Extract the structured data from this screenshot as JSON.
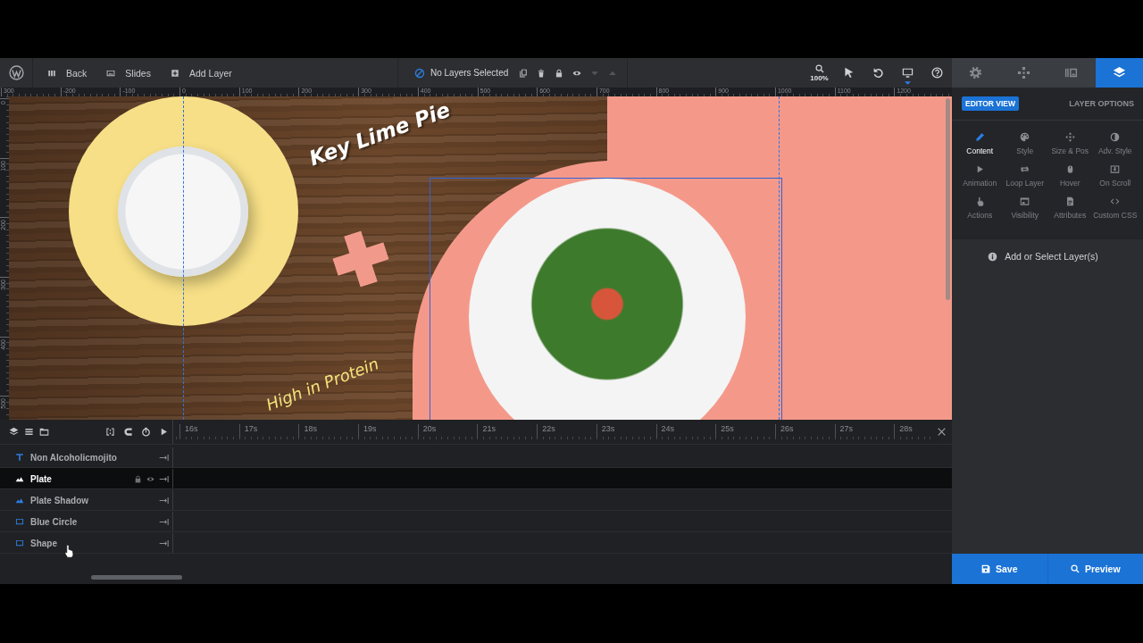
{
  "toolbar": {
    "nav": [
      {
        "kind": "back",
        "label": "Back"
      },
      {
        "kind": "slides",
        "label": "Slides"
      },
      {
        "kind": "add",
        "label": "Add Layer"
      }
    ],
    "selection": "No Layers Selected",
    "layer_actions": [
      {
        "kind": "copy",
        "disabled": false
      },
      {
        "kind": "delete",
        "disabled": false
      },
      {
        "kind": "lock",
        "disabled": false
      },
      {
        "kind": "visibility",
        "disabled": false
      },
      {
        "kind": "move-down",
        "disabled": true
      },
      {
        "kind": "move-up",
        "disabled": true
      }
    ],
    "tools": [
      {
        "kind": "zoom",
        "label": "100%"
      },
      {
        "kind": "pointer"
      },
      {
        "kind": "undo"
      },
      {
        "kind": "device"
      },
      {
        "kind": "help"
      }
    ]
  },
  "panel_tabs": [
    {
      "kind": "settings",
      "selected": false
    },
    {
      "kind": "navigation",
      "selected": false
    },
    {
      "kind": "slides",
      "selected": false
    },
    {
      "kind": "layers",
      "selected": true
    }
  ],
  "ruler": {
    "x_labels": [
      "300",
      "-200",
      "-100",
      "0",
      "100",
      "200",
      "300",
      "400",
      "500",
      "600",
      "700",
      "800",
      "900",
      "1000",
      "1100",
      "1200"
    ],
    "y_labels": [
      "0",
      "100",
      "200",
      "300",
      "400",
      "500"
    ]
  },
  "canvas": {
    "title": "Key Lime Pie",
    "tagline": "High in Protein"
  },
  "timeline": {
    "view_tools": [
      {
        "kind": "layers"
      },
      {
        "kind": "list"
      },
      {
        "kind": "folder"
      }
    ],
    "playback_tools": [
      {
        "kind": "snap"
      },
      {
        "kind": "magnet"
      },
      {
        "kind": "timer"
      },
      {
        "kind": "play"
      }
    ],
    "time_labels": [
      "16s",
      "17s",
      "18s",
      "19s",
      "20s",
      "21s",
      "22s",
      "23s",
      "24s",
      "25s",
      "26s",
      "27s",
      "28s"
    ],
    "layers": [
      {
        "kind": "text",
        "name": "Non Alcoholicmojito",
        "selected": false
      },
      {
        "kind": "image",
        "name": "Plate",
        "selected": true
      },
      {
        "kind": "image",
        "name": "Plate Shadow",
        "selected": false
      },
      {
        "kind": "shape",
        "name": "Blue Circle",
        "selected": false
      },
      {
        "kind": "shape",
        "name": "Shape",
        "selected": false
      }
    ]
  },
  "layer_options": {
    "badge": "EDITOR VIEW",
    "title": "LAYER OPTIONS",
    "options": [
      {
        "kind": "content",
        "label": "Content",
        "selected": true
      },
      {
        "kind": "style",
        "label": "Style",
        "selected": false
      },
      {
        "kind": "size",
        "label": "Size & Pos",
        "selected": false
      },
      {
        "kind": "adv-style",
        "label": "Adv. Style",
        "selected": false
      },
      {
        "kind": "animation",
        "label": "Animation",
        "selected": false
      },
      {
        "kind": "loop",
        "label": "Loop Layer",
        "selected": false
      },
      {
        "kind": "hover",
        "label": "Hover",
        "selected": false
      },
      {
        "kind": "on-scroll",
        "label": "On Scroll",
        "selected": false
      },
      {
        "kind": "actions",
        "label": "Actions",
        "selected": false
      },
      {
        "kind": "visibility",
        "label": "Visibility",
        "selected": false
      },
      {
        "kind": "attributes",
        "label": "Attributes",
        "selected": false
      },
      {
        "kind": "custom-css",
        "label": "Custom CSS",
        "selected": false
      }
    ],
    "hint": "Add or Select Layer(s)"
  },
  "footer_buttons": [
    {
      "kind": "save",
      "label": "Save"
    },
    {
      "kind": "preview",
      "label": "Preview"
    }
  ]
}
